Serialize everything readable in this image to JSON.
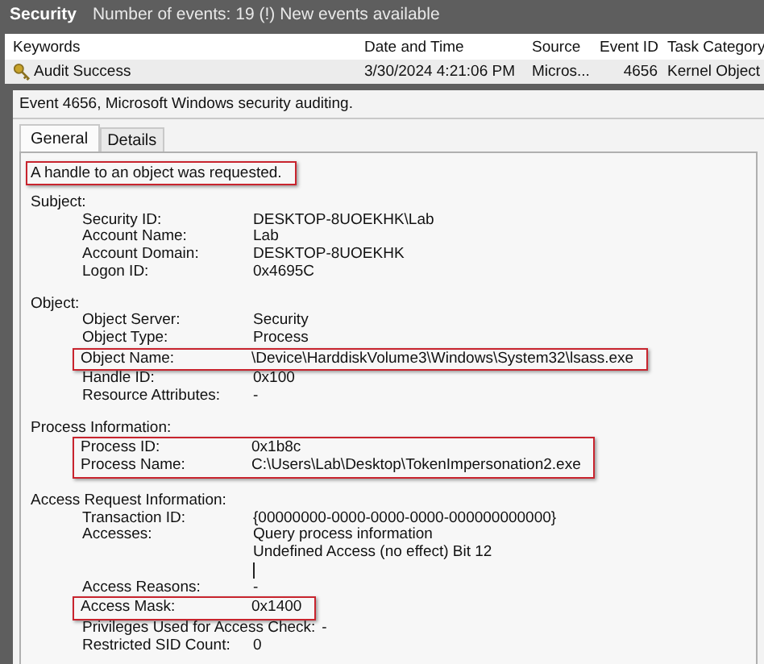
{
  "header": {
    "title": "Security",
    "info": "Number of events: 19 (!) New events available"
  },
  "table": {
    "columns": [
      "Keywords",
      "Date and Time",
      "Source",
      "Event ID",
      "Task Category"
    ],
    "rows": [
      {
        "selected": true,
        "cells": [
          "Audit Success",
          "3/30/2024 4:21:06 PM",
          "Micros...",
          "4656",
          "Kernel Object"
        ]
      }
    ]
  },
  "detail": {
    "title": "Event 4656, Microsoft Windows security auditing.",
    "tabs": [
      {
        "label": "General",
        "selected": true
      },
      {
        "label": "Details",
        "selected": false
      }
    ],
    "message": {
      "text": "A handle to an object was requested.",
      "highlighted": true
    },
    "sections": [
      {
        "title": "Subject:",
        "fields": [
          {
            "label": "Security ID:",
            "values": [
              "DESKTOP-8UOEKHK\\Lab"
            ],
            "highlighted": false
          },
          {
            "label": "Account Name:",
            "values": [
              "Lab"
            ],
            "highlighted": false
          },
          {
            "label": "Account Domain:",
            "values": [
              "DESKTOP-8UOEKHK"
            ],
            "highlighted": false
          },
          {
            "label": "Logon ID:",
            "values": [
              "0x4695C"
            ],
            "highlighted": false
          }
        ]
      },
      {
        "title": "Object:",
        "fields": [
          {
            "label": "Object Server:",
            "values": [
              "Security"
            ],
            "highlighted": false
          },
          {
            "label": "Object Type:",
            "values": [
              "Process"
            ],
            "highlighted": false
          },
          {
            "label": "Object Name:",
            "values": [
              "\\Device\\HarddiskVolume3\\Windows\\System32\\lsass.exe"
            ],
            "highlighted": true
          },
          {
            "label": "Handle ID:",
            "values": [
              "0x100"
            ],
            "highlighted": false
          },
          {
            "label": "Resource Attributes:",
            "values": [
              "-"
            ],
            "highlighted": false
          }
        ]
      },
      {
        "title": "Process Information:",
        "fields": [
          {
            "label": "Process ID:",
            "values": [
              "0x1b8c"
            ],
            "highlighted": true
          },
          {
            "label": "Process Name:",
            "values": [
              "C:\\Users\\Lab\\Desktop\\TokenImpersonation2.exe"
            ],
            "highlighted": true
          }
        ]
      },
      {
        "title": "Access Request Information:",
        "fields": [
          {
            "label": "Transaction ID:",
            "values": [
              "{00000000-0000-0000-0000-000000000000}"
            ],
            "highlighted": false
          },
          {
            "label": "Accesses:",
            "values": [
              "Query process information",
              "Undefined Access (no effect) Bit 12"
            ],
            "caret_line": true,
            "highlighted": false
          },
          {
            "label": "Access Reasons:",
            "values": [
              "-"
            ],
            "highlighted": false
          },
          {
            "label": "Access Mask:",
            "values": [
              "0x1400"
            ],
            "highlighted": true
          },
          {
            "label": "Privileges Used for Access Check:",
            "values": [
              "-"
            ],
            "highlighted": false
          },
          {
            "label": "Restricted SID Count:",
            "values": [
              "0"
            ],
            "highlighted": false
          }
        ]
      }
    ]
  }
}
